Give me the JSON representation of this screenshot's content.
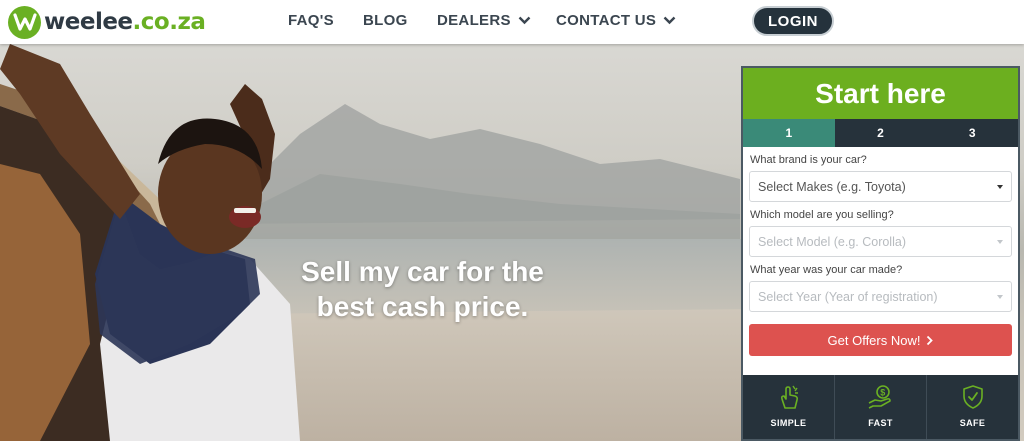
{
  "header": {
    "logo_text": "weelee",
    "logo_tld": ".co.za",
    "nav": [
      {
        "label": "FAQ'S"
      },
      {
        "label": "BLOG"
      },
      {
        "label": "DEALERS"
      },
      {
        "label": "CONTACT US"
      }
    ],
    "login_label": "LOGIN"
  },
  "hero": {
    "headline": "Sell my car for the best cash price."
  },
  "form": {
    "title": "Start here",
    "steps": [
      "1",
      "2",
      "3"
    ],
    "active_step": "1",
    "fields": [
      {
        "label": "What brand is your car?",
        "placeholder": "Select Makes (e.g. Toyota)"
      },
      {
        "label": "Which model are you selling?",
        "placeholder": "Select Model (e.g. Corolla)"
      },
      {
        "label": "What year was your car made?",
        "placeholder": "Select Year (Year of registration)"
      }
    ],
    "cta_label": "Get Offers Now!",
    "features": [
      {
        "label": "SIMPLE",
        "icon": "hand-click-icon"
      },
      {
        "label": "FAST",
        "icon": "hand-money-icon"
      },
      {
        "label": "SAFE",
        "icon": "shield-check-icon"
      }
    ]
  },
  "colors": {
    "brand_green": "#6caf1f",
    "dark_navy": "#26323b",
    "step_active": "#3a8a78",
    "cta_red": "#dd524f",
    "icon_green": "#6ab023"
  }
}
